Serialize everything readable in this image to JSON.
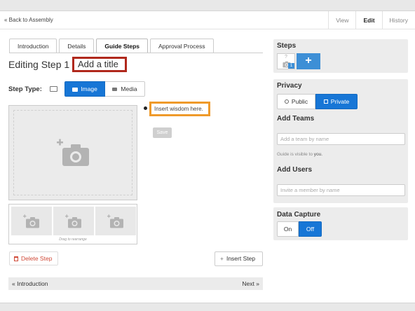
{
  "nav": {
    "back_label": "« Back to Assembly",
    "tabs": [
      {
        "label": "View",
        "active": false
      },
      {
        "label": "Edit",
        "active": true
      },
      {
        "label": "History",
        "active": false
      }
    ]
  },
  "guide_tabs": [
    {
      "label": "Introduction",
      "active": false
    },
    {
      "label": "Details",
      "active": false
    },
    {
      "label": "Guide Steps",
      "active": true
    },
    {
      "label": "Approval Process",
      "active": false
    }
  ],
  "editor": {
    "heading": "Editing Step 1 -",
    "title_placeholder": "Add a title",
    "step_type_label": "Step Type:",
    "step_type_options": [
      {
        "label": "Image",
        "icon": "camera-icon",
        "selected": true
      },
      {
        "label": "Media",
        "icon": "video-icon",
        "selected": false
      }
    ],
    "wisdom_placeholder": "Insert wisdom here.",
    "save_label": "Save",
    "drag_hint": "Drag to rearrange",
    "delete_label": "Delete Step",
    "insert_label": "Insert Step",
    "prev_label": "« Introduction",
    "next_label": "Next »"
  },
  "sidebar": {
    "steps": {
      "title": "Steps",
      "thumb_label": "?",
      "step_number": "1",
      "add_icon": "plus-icon"
    },
    "privacy": {
      "title": "Privacy",
      "public_label": "Public",
      "private_label": "Private",
      "selected": "Private"
    },
    "teams": {
      "title": "Add Teams",
      "placeholder": "Add a team by name",
      "note_prefix": "Guide is visible to",
      "note_value": "you."
    },
    "users": {
      "title": "Add Users",
      "placeholder": "Invite a member by name"
    },
    "data_capture": {
      "title": "Data Capture",
      "on_label": "On",
      "off_label": "Off",
      "selected": "Off"
    }
  },
  "colors": {
    "accent_blue": "#1776d6",
    "title_highlight": "#b0281c",
    "wisdom_highlight": "#ef9a2a",
    "delete_red": "#d04a38"
  }
}
